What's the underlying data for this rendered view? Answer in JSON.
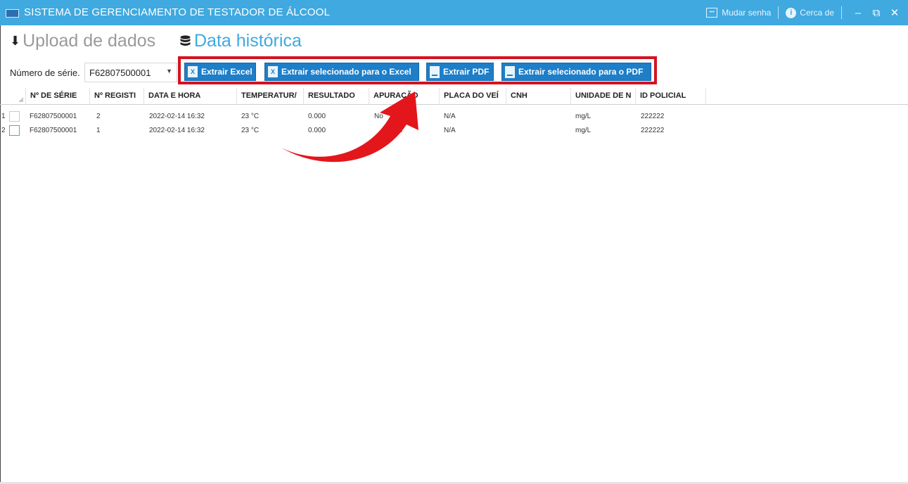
{
  "window": {
    "title": "SISTEMA DE GERENCIAMENTO DE TESTADOR DE ÁLCOOL",
    "change_password": "Mudar senha",
    "about": "Cerca de",
    "minimize": "‒",
    "restore": "⧉",
    "close": "✕"
  },
  "tabs": {
    "upload": "Upload de dados",
    "history": "Data histórica"
  },
  "toolbar": {
    "serial_label": "Número de série.",
    "serial_value": "F62807500001",
    "extract_excel": "Extrair Excel",
    "extract_selected_excel": "Extrair selecionado para o Excel",
    "extract_pdf": "Extrair PDF",
    "extract_selected_pdf": "Extrair selecionado para o PDF"
  },
  "table": {
    "columns": [
      "Nº DE SÉRIE",
      "Nº REGISTI",
      "DATA E HORA",
      "TEMPERATUR/",
      "RESULTADO",
      "APURAÇÃO",
      "PLACA DO VEÍ",
      "CNH",
      "UNIDADE DE N",
      "ID POLICIAL"
    ],
    "rows": [
      {
        "index": "1",
        "serial": "F62807500001",
        "reg": "2",
        "datetime": "2022-02-14 16:32",
        "temp": "23 °C",
        "result": "0.000",
        "apuracao": "No",
        "plate": "N/A",
        "cnh": "",
        "unit": "mg/L",
        "police_id": "222222"
      },
      {
        "index": "2",
        "serial": "F62807500001",
        "reg": "1",
        "datetime": "2022-02-14 16:32",
        "temp": "23 °C",
        "result": "0.000",
        "apuracao": "mal",
        "plate": "N/A",
        "cnh": "",
        "unit": "mg/L",
        "police_id": "222222"
      }
    ]
  },
  "colors": {
    "titlebar": "#3fa9e0",
    "button": "#1e7ec8",
    "highlight": "#d6121f"
  }
}
